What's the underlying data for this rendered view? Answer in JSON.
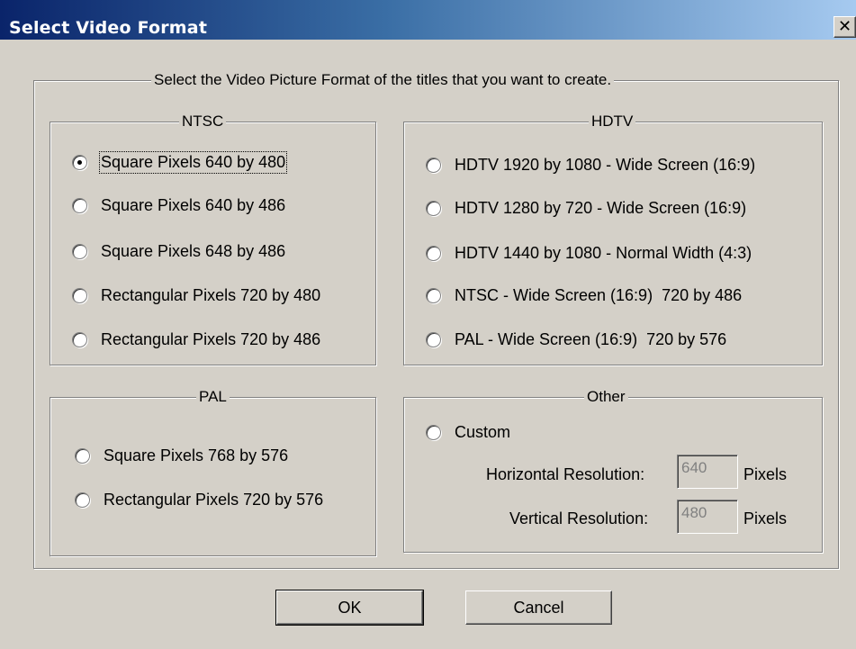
{
  "window": {
    "title": "Select Video Format",
    "close_glyph": "✕"
  },
  "main_group": {
    "legend": "Select the Video Picture Format of the titles that you want to create."
  },
  "ntsc": {
    "legend": "NTSC",
    "options": [
      {
        "label": "Square Pixels 640 by 480",
        "checked": true
      },
      {
        "label": "Square Pixels 640 by 486",
        "checked": false
      },
      {
        "label": "Square Pixels 648 by 486",
        "checked": false
      },
      {
        "label": "Rectangular Pixels 720 by 480",
        "checked": false
      },
      {
        "label": "Rectangular Pixels 720 by 486",
        "checked": false
      }
    ]
  },
  "hdtv": {
    "legend": "HDTV",
    "options": [
      {
        "label": "HDTV 1920 by 1080 - Wide Screen (16:9)",
        "checked": false
      },
      {
        "label": "HDTV 1280 by 720 - Wide Screen (16:9)",
        "checked": false
      },
      {
        "label": "HDTV 1440 by 1080 - Normal Width (4:3)",
        "checked": false
      },
      {
        "label": "NTSC - Wide Screen (16:9)  720 by 486",
        "checked": false
      },
      {
        "label": "PAL - Wide Screen (16:9)  720 by 576",
        "checked": false
      }
    ]
  },
  "pal": {
    "legend": "PAL",
    "options": [
      {
        "label": "Square Pixels 768 by 576",
        "checked": false
      },
      {
        "label": "Rectangular Pixels 720 by 576",
        "checked": false
      }
    ]
  },
  "other": {
    "legend": "Other",
    "custom_label": "Custom",
    "custom_checked": false,
    "horizontal_label": "Horizontal Resolution:",
    "horizontal_value": "640",
    "vertical_label": "Vertical Resolution:",
    "vertical_value": "480",
    "units": "Pixels"
  },
  "buttons": {
    "ok": "OK",
    "cancel": "Cancel"
  }
}
